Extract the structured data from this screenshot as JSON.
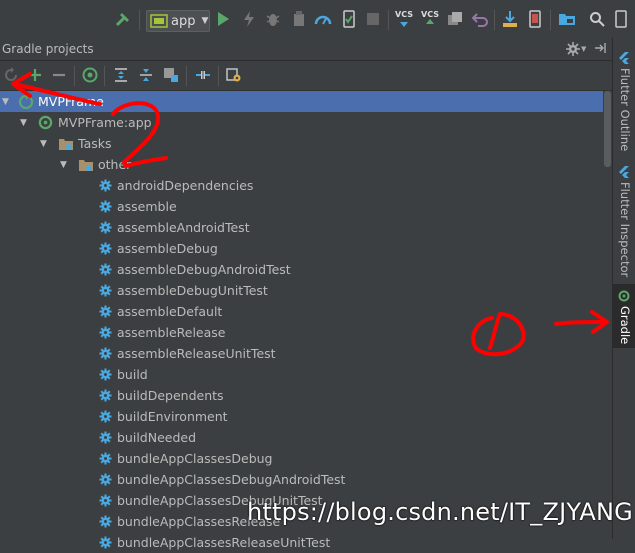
{
  "toolbar": {
    "run_config": "app",
    "vcs_label_1": "VCS",
    "vcs_label_2": "VCS"
  },
  "panel": {
    "title": "Gradle projects"
  },
  "tree": {
    "root": "MVPFrame",
    "module": "MVPFrame:app",
    "tasks": "Tasks",
    "other": "other",
    "items": [
      "androidDependencies",
      "assemble",
      "assembleAndroidTest",
      "assembleDebug",
      "assembleDebugAndroidTest",
      "assembleDebugUnitTest",
      "assembleDefault",
      "assembleRelease",
      "assembleReleaseUnitTest",
      "build",
      "buildDependents",
      "buildEnvironment",
      "buildNeeded",
      "bundleAppClassesDebug",
      "bundleAppClassesDebugAndroidTest",
      "bundleAppClassesDebugUnitTest",
      "bundleAppClassesRelease",
      "bundleAppClassesReleaseUnitTest"
    ]
  },
  "side_tabs": {
    "flutter_outline": "Flutter Outline",
    "flutter_inspector": "Flutter Inspector",
    "gradle": "Gradle"
  },
  "watermark": "https://blog.csdn.net/IT_ZJYANG",
  "annotations": {
    "mark_1": "1",
    "mark_2": "2"
  },
  "colors": {
    "panel_bg": "#3c3f41",
    "selection": "#4b6eaf",
    "annotation_red": "#ff0000",
    "gear_blue": "#4aa8e0",
    "run_green": "#59a869"
  }
}
